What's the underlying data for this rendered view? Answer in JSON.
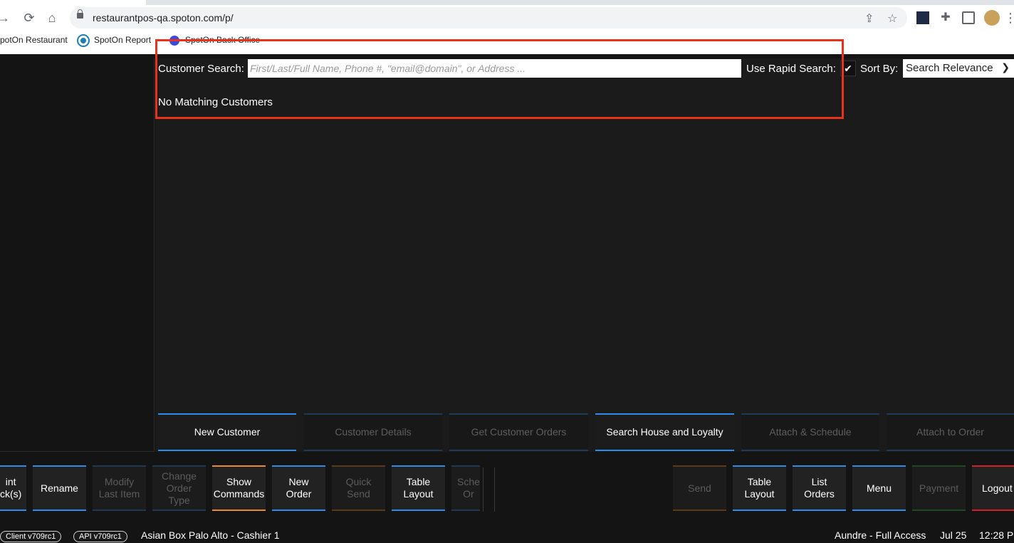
{
  "browser": {
    "url": "restaurantpos-qa.spoton.com/p/",
    "bookmarks": [
      {
        "label": "potOn Restaurant"
      },
      {
        "label": "SpotOn  Report"
      },
      {
        "label": "SpotOn Back Office"
      }
    ]
  },
  "search": {
    "label": "Customer Search:",
    "placeholder": "First/Last/Full Name, Phone #, \"email@domain\", or Address ...",
    "rapid_label": "Use Rapid Search:",
    "rapid_checked": true,
    "sort_label": "Sort By:",
    "sort_value": "Search Relevance",
    "result_text": "No Matching Customers"
  },
  "actions": [
    {
      "label": "New Customer",
      "enabled": true
    },
    {
      "label": "Customer Details",
      "enabled": false
    },
    {
      "label": "Get Customer Orders",
      "enabled": false
    },
    {
      "label": "Search House and Loyalty",
      "enabled": true
    },
    {
      "label": "Attach & Schedule",
      "enabled": false
    },
    {
      "label": "Attach to Order",
      "enabled": false
    }
  ],
  "commands": {
    "print_checks": "int\nck(s)",
    "rename": "Rename",
    "modify_last_item": "Modify\nLast Item",
    "change_order_type": "Change\nOrder\nType",
    "show_commands": "Show\nCommands",
    "new_order": "New\nOrder",
    "quick_send": "Quick\nSend",
    "table_layout_left": "Table\nLayout",
    "schedule_order": "Sche\nOr",
    "send": "Send",
    "table_layout_right": "Table\nLayout",
    "list_orders": "List\nOrders",
    "menu": "Menu",
    "payment": "Payment",
    "logout": "Logout"
  },
  "status": {
    "client_version": "Client v709rc1",
    "api_version": "API v709rc1",
    "location": "Asian Box Palo Alto - Cashier 1",
    "user": "Aundre - Full Access",
    "date": "Jul 25",
    "time": "12:28 P"
  },
  "colors": {
    "accent_blue": "#2f8ae8",
    "accent_orange": "#e98a2c",
    "accent_red": "#d3202a",
    "highlight": "#e8321c"
  }
}
